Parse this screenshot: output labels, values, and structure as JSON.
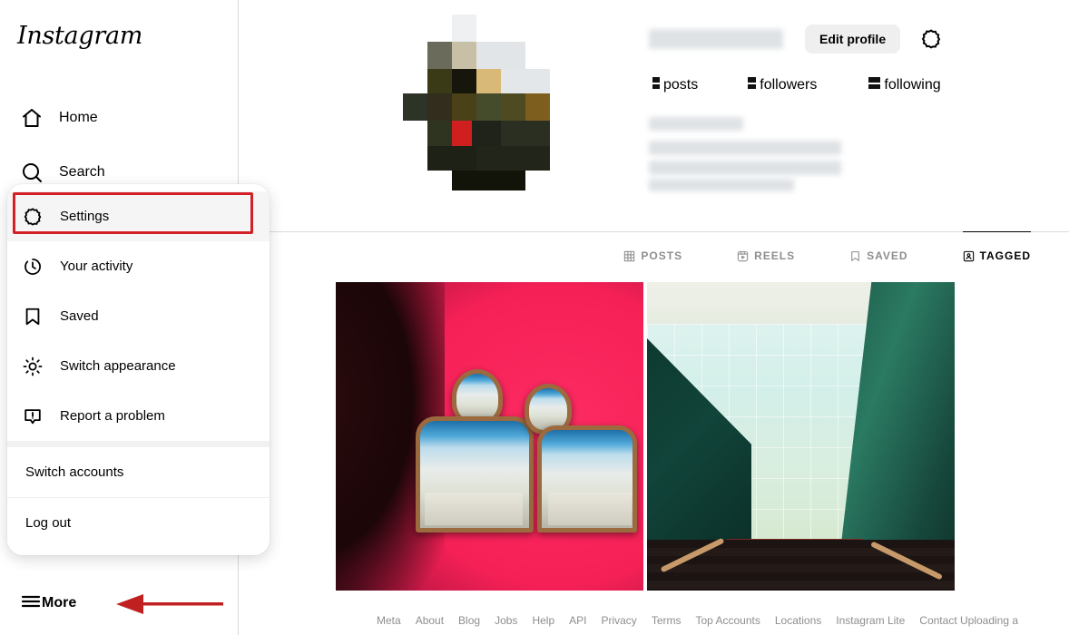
{
  "brand": {
    "logo_text": "Instagram",
    "accent_red": "#d32026",
    "muted_gray": "#8e8e8e"
  },
  "sidebar": {
    "items": [
      {
        "label": "Home",
        "icon": "home-icon"
      },
      {
        "label": "Search",
        "icon": "search-icon"
      }
    ],
    "more": {
      "label": "More",
      "icon": "hamburger-menu-icon"
    }
  },
  "more_menu": {
    "items": [
      {
        "label": "Settings",
        "icon": "gear-icon",
        "highlighted": true
      },
      {
        "label": "Your activity",
        "icon": "clock-activity-icon"
      },
      {
        "label": "Saved",
        "icon": "bookmark-icon"
      },
      {
        "label": "Switch appearance",
        "icon": "sun-icon"
      },
      {
        "label": "Report a problem",
        "icon": "exclamation-bubble-icon"
      }
    ],
    "account_items": [
      {
        "label": "Switch accounts"
      },
      {
        "label": "Log out"
      }
    ]
  },
  "profile": {
    "username": "",
    "full_name": "",
    "bio": "",
    "edit_profile_label": "Edit profile",
    "settings_icon": "gear-icon",
    "stats": [
      {
        "value": "",
        "label": "posts"
      },
      {
        "value": "",
        "label": "followers"
      },
      {
        "value": "",
        "label": "following"
      }
    ]
  },
  "tabs": [
    {
      "label": "POSTS",
      "icon": "grid-icon",
      "active": false
    },
    {
      "label": "REELS",
      "icon": "reels-icon",
      "active": false
    },
    {
      "label": "SAVED",
      "icon": "bookmark-icon",
      "active": false
    },
    {
      "label": "TAGGED",
      "icon": "tagged-person-icon",
      "active": true
    }
  ],
  "grid": [
    {
      "name": "post-thumbnail-pink-mirrors",
      "alt": "Two silhouette-shaped mirrors on a pink wall"
    },
    {
      "name": "post-thumbnail-green-stairwell",
      "alt": "Green stairwell with curved glowing skylight"
    }
  ],
  "footer": {
    "links": [
      "Meta",
      "About",
      "Blog",
      "Jobs",
      "Help",
      "API",
      "Privacy",
      "Terms",
      "Top Accounts",
      "Locations",
      "Instagram Lite",
      "Contact Uploading a"
    ]
  }
}
